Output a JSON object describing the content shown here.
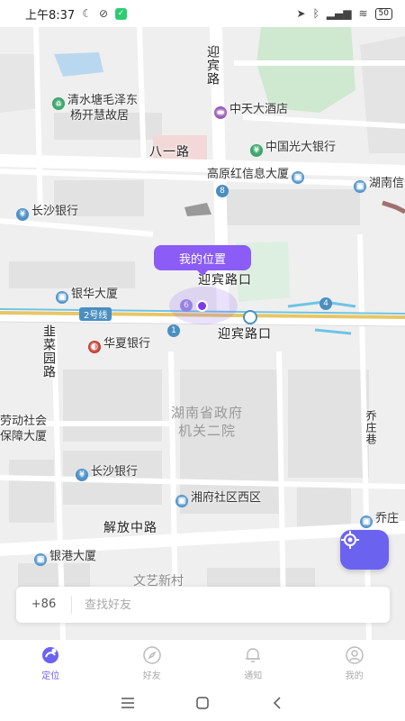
{
  "status_bar": {
    "time": "上午8:37",
    "battery": "50"
  },
  "map": {
    "my_position_label": "我的位置",
    "road_labels": {
      "yingbin_road_vertical": "迎宾路",
      "bayi_road": "八一路",
      "yingbin_intersection_top": "迎宾路口",
      "yingbin_intersection_bottom": "迎宾路口",
      "jiefang_road": "解放中路",
      "beicai_road": "韭菜园路",
      "qiaozhuang_lane": "乔庄巷"
    },
    "pois": {
      "mao_residence_line1": "清水塘毛泽东",
      "mao_residence_line2": "杨开慧故居",
      "zhongtian_hotel": "中天大酒店",
      "everbright_bank": "中国光大银行",
      "gaoyuanhong_building": "高原红信息大厦",
      "hunan_partial": "湖南信",
      "changsha_bank_top": "长沙银行",
      "yinhua_building": "银华大厦",
      "huaxia_bank": "华夏银行",
      "labor_line1": "劳动社会",
      "labor_line2": "保障大厦",
      "changsha_bank_bottom": "长沙银行",
      "xiangfu_community": "湘府社区西区",
      "qiaozhuang_partial": "乔庄",
      "yingang_building": "银港大厦",
      "wenyi_village": "文艺新村"
    },
    "district_line1": "湖南省政府",
    "district_line2": "机关二院",
    "route_badges": {
      "line2": "2号线",
      "b8": "8",
      "b4": "4",
      "b1": "1",
      "b6": "6"
    }
  },
  "search": {
    "country_code": "+86",
    "placeholder": "查找好友"
  },
  "tabs": [
    {
      "label": "定位",
      "icon": "location-icon",
      "active": true
    },
    {
      "label": "好友",
      "icon": "compass-icon",
      "active": false
    },
    {
      "label": "通知",
      "icon": "bell-icon",
      "active": false
    },
    {
      "label": "我的",
      "icon": "profile-icon",
      "active": false
    }
  ],
  "colors": {
    "accent": "#6b63f0",
    "bubble": "#8b5cf6",
    "park_green": "#cfe8d0",
    "metro_yellow": "#e8c667"
  }
}
